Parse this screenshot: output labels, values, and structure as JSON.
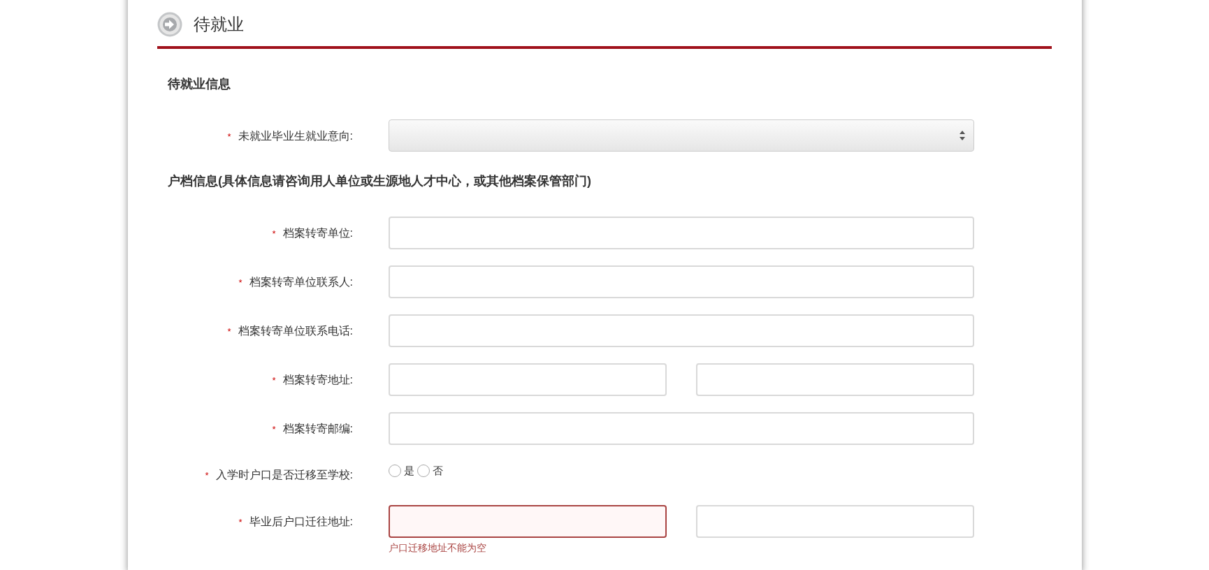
{
  "page_title": "待就业",
  "sections": [
    {
      "heading": "待就业信息",
      "fields": [
        {
          "marker": "*",
          "label": "未就业毕业生就业意向:",
          "kind": "select",
          "inputs": [
            {
              "invalid": false
            }
          ]
        }
      ]
    },
    {
      "heading": "户档信息(具体信息请咨询用人单位或生源地人才中心，或其他档案保管部门)",
      "fields": [
        {
          "marker": "*",
          "label": "档案转寄单位:",
          "kind": "text",
          "inputs": [
            {
              "invalid": false
            }
          ]
        },
        {
          "marker": "*",
          "label": "档案转寄单位联系人:",
          "kind": "text",
          "inputs": [
            {
              "invalid": false
            }
          ]
        },
        {
          "marker": "*",
          "label": "档案转寄单位联系电话:",
          "kind": "text",
          "inputs": [
            {
              "invalid": false
            }
          ]
        },
        {
          "marker": "*",
          "label": "档案转寄地址:",
          "kind": "text",
          "inputs": [
            {
              "invalid": false
            },
            {
              "invalid": false
            }
          ]
        },
        {
          "marker": "*",
          "label": "档案转寄邮编:",
          "kind": "text",
          "inputs": [
            {
              "invalid": false
            }
          ]
        },
        {
          "marker": "*",
          "label": "入学时户口是否迁移至学校:",
          "kind": "radio",
          "options": [
            {
              "label": "是",
              "selected": false
            },
            {
              "label": "否",
              "selected": false
            }
          ]
        },
        {
          "marker": "*",
          "label": "毕业后户口迁往地址:",
          "kind": "text",
          "inputs": [
            {
              "invalid": true
            },
            {
              "invalid": false
            }
          ],
          "error_message": "户口迁移地址不能为空"
        }
      ]
    }
  ]
}
